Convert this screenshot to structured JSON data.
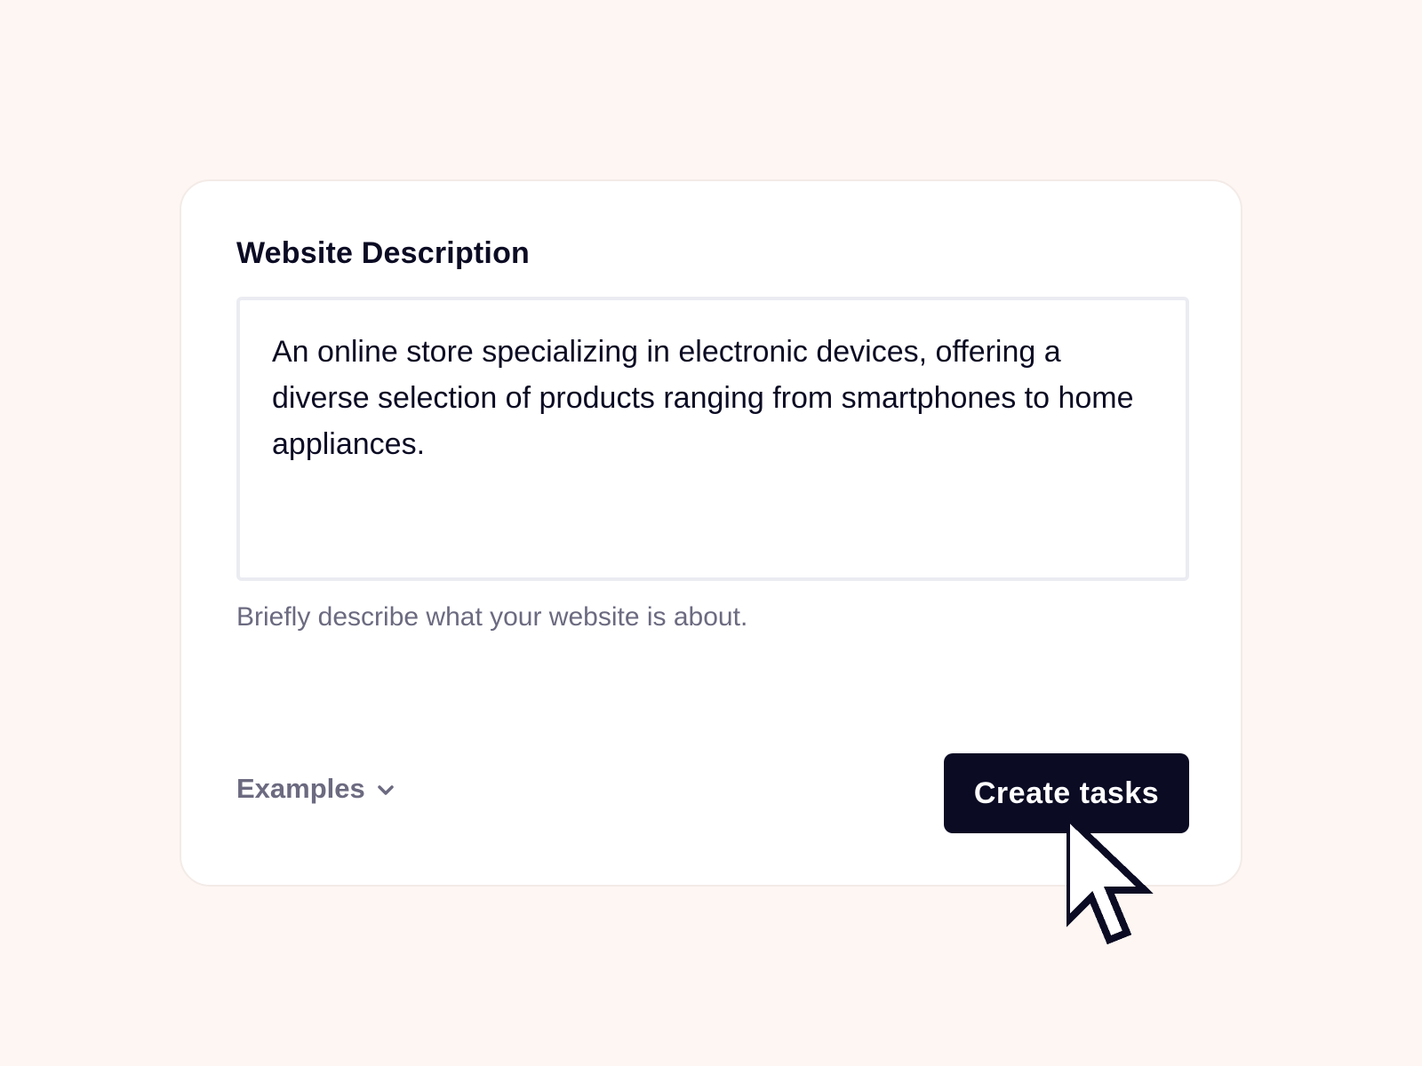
{
  "form": {
    "label": "Website Description",
    "description_value": "An online store specializing in electronic devices, offering a diverse selection of products ranging from smartphones to home appliances.",
    "helper_text": "Briefly describe what your website is about."
  },
  "footer": {
    "examples_label": "Examples",
    "examples_icon": "chevron-down-icon",
    "create_button_label": "Create tasks"
  },
  "cursor": {
    "icon": "pointer-cursor-icon"
  },
  "colors": {
    "background": "#fdf6f2",
    "card": "#ffffff",
    "primary_text": "#0b0b24",
    "muted_text": "#6b6a80",
    "button_bg": "#0b0b24",
    "input_border": "#ebecf2"
  }
}
